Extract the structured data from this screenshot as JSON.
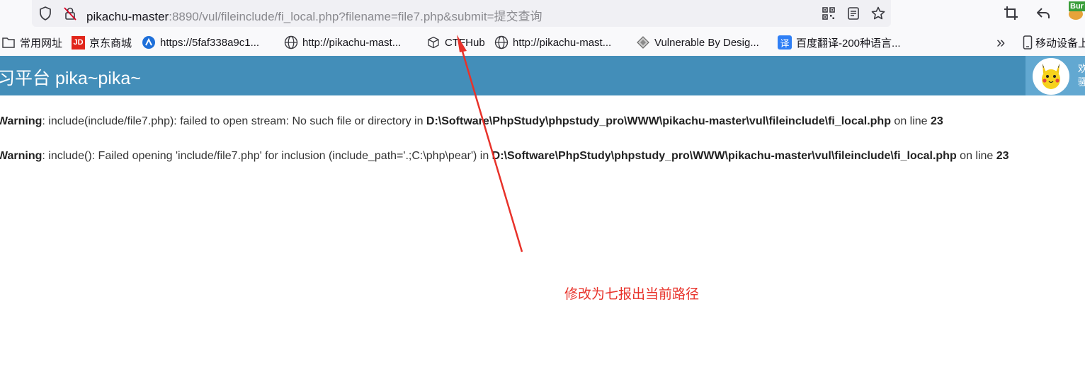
{
  "browser": {
    "url_host": "pikachu-master",
    "url_rest": ":8890/vul/fileinclude/fi_local.php?filename=file7.php&submit=提交查询",
    "ext_badge": "Bur",
    "bookmarks": [
      {
        "label": "常用网址",
        "icon": "folder-icon"
      },
      {
        "label": "京东商城",
        "icon": "jd-icon"
      },
      {
        "label": "https://5faf338a9c1...",
        "icon": "site-icon"
      },
      {
        "label": "http://pikachu-mast...",
        "icon": "globe-icon"
      },
      {
        "label": "CTFHub",
        "icon": "cube-icon"
      },
      {
        "label": "http://pikachu-mast...",
        "icon": "globe-icon"
      },
      {
        "label": "Vulnerable By Desig...",
        "icon": "vulnhub-icon"
      },
      {
        "label": "百度翻译-200种语言...",
        "icon": "translate-icon"
      },
      {
        "label": "移动设备上",
        "icon": "mobile-icon"
      }
    ],
    "translate_glyph": "译",
    "jd_glyph": "JD",
    "overflow_glyph": "»"
  },
  "app": {
    "title": "习平台 pika~pika~",
    "user_line1": "欢",
    "user_line2": "骚"
  },
  "warnings": [
    {
      "label": "Warning",
      "message": ": include(include/file7.php): failed to open stream: No such file or directory in ",
      "path": "D:\\Software\\PhpStudy\\phpstudy_pro\\WWW\\pikachu-master\\vul\\fileinclude\\fi_local.php",
      "on_line": " on line ",
      "line": "23"
    },
    {
      "label": "Warning",
      "message": ": include(): Failed opening 'include/file7.php' for inclusion (include_path='.;C:\\php\\pear') in ",
      "path": "D:\\Software\\PhpStudy\\phpstudy_pro\\WWW\\pikachu-master\\vul\\fileinclude\\fi_local.php",
      "on_line": " on line ",
      "line": "23"
    }
  ],
  "annotation": {
    "text": "修改为七报出当前路径",
    "color": "#e8322a"
  },
  "colors": {
    "header": "#438eb9",
    "user_box": "#62a8d1"
  }
}
